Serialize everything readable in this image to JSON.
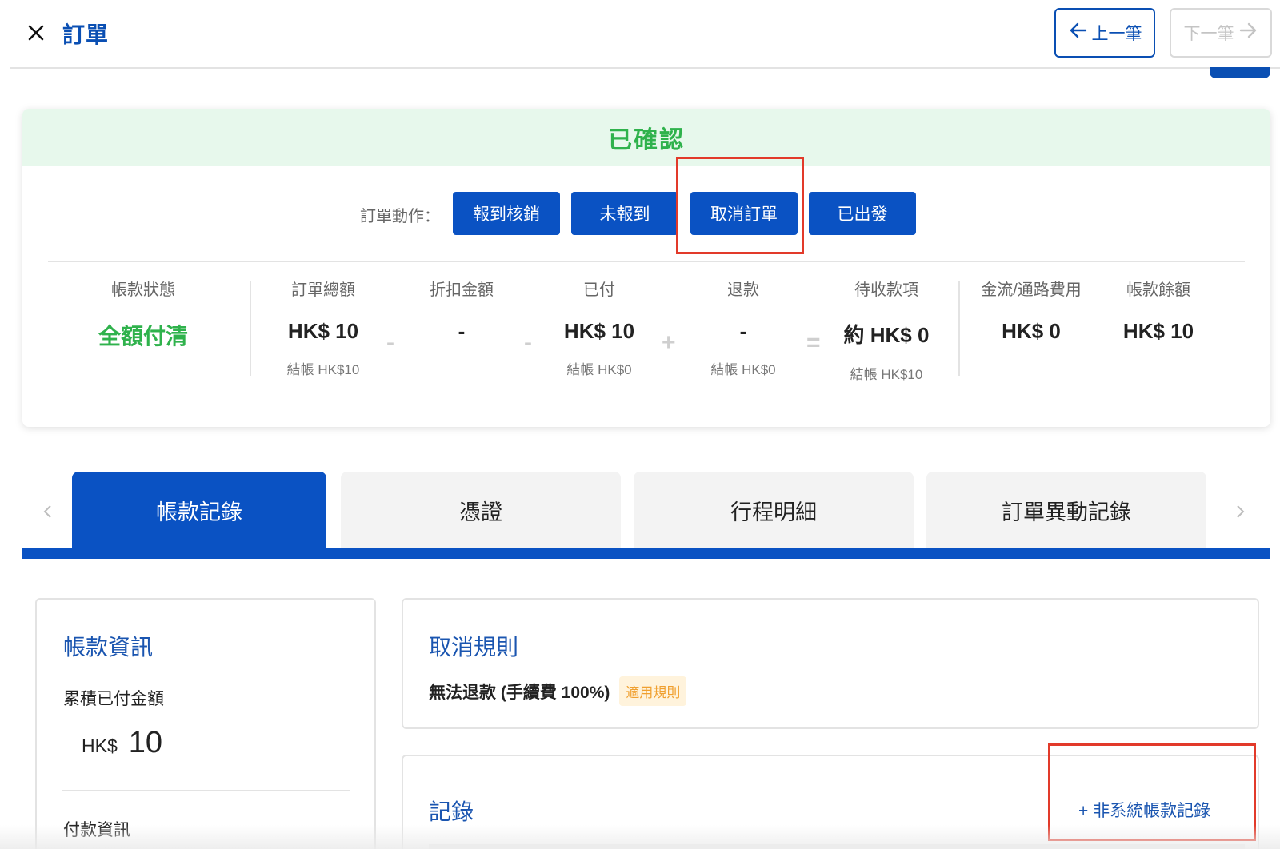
{
  "header": {
    "title": "訂單",
    "prev_label": "上一筆",
    "next_label": "下一筆"
  },
  "status": {
    "label": "已確認",
    "color": "#2fb24c"
  },
  "order_actions": {
    "label": "訂單動作：",
    "buttons": [
      "報到核銷",
      "未報到",
      "取消訂單",
      "已出發"
    ]
  },
  "summary": {
    "payment_status_header": "帳款狀態",
    "payment_status_value": "全額付清",
    "columns": [
      {
        "header": "訂單總額",
        "value": "HK$ 10",
        "sub": "結帳 HK$10"
      },
      {
        "header": "折扣金額",
        "value": "-",
        "sub": ""
      },
      {
        "header": "已付",
        "value": "HK$ 10",
        "sub": "結帳 HK$0"
      },
      {
        "header": "退款",
        "value": "-",
        "sub": "結帳 HK$0"
      },
      {
        "header": "待收款項",
        "value": "約 HK$ 0",
        "sub": "結帳 HK$10"
      },
      {
        "header": "金流/通路費用",
        "value": "HK$ 0",
        "sub": ""
      },
      {
        "header": "帳款餘額",
        "value": "HK$ 10",
        "sub": ""
      }
    ],
    "operators": [
      "-",
      "-",
      "+",
      "="
    ]
  },
  "tabs": [
    "帳款記錄",
    "憑證",
    "行程明細",
    "訂單異動記錄"
  ],
  "active_tab": "帳款記錄",
  "billing_info": {
    "title": "帳款資訊",
    "paid_label": "累積已付金額",
    "currency": "HK$",
    "amount": "10",
    "payment_info_label": "付款資訊"
  },
  "cancel_rules": {
    "title": "取消規則",
    "rule": "無法退款 (手續費 100%)",
    "badge": "適用規則"
  },
  "records": {
    "title": "記錄",
    "add_link": "+ 非系統帳款記錄"
  },
  "colors": {
    "primary": "#0a52c3",
    "title_blue": "#0a4fb3",
    "success_green": "#2fb24c",
    "highlight_red": "#e23a2a",
    "badge_orange": "#f0a030"
  }
}
